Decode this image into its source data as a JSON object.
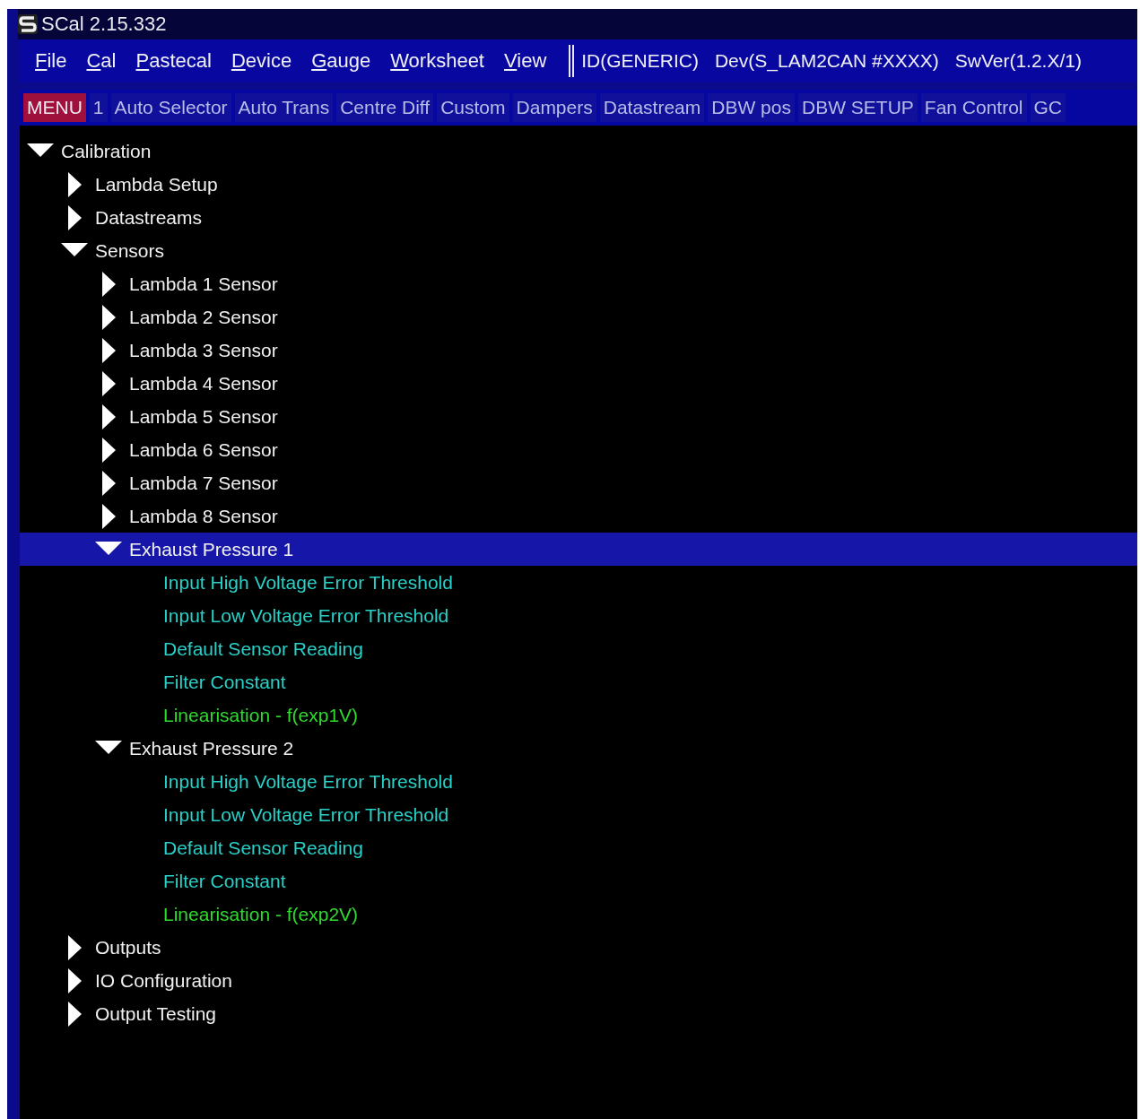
{
  "window": {
    "title": "SCal 2.15.332"
  },
  "menu": [
    {
      "key": "F",
      "rest": "ile"
    },
    {
      "key": "C",
      "rest": "al"
    },
    {
      "key": "P",
      "rest": "astecal"
    },
    {
      "key": "D",
      "rest": "evice"
    },
    {
      "key": "G",
      "rest": "auge"
    },
    {
      "key": "W",
      "rest": "orksheet"
    },
    {
      "key": "V",
      "rest": "iew"
    }
  ],
  "info": [
    "ID(GENERIC)",
    "Dev(S_LAM2CAN #XXXX)",
    "SwVer(1.2.X/1)"
  ],
  "tabs": [
    {
      "label": "MENU",
      "selected": true
    },
    {
      "label": "1",
      "selected": false
    },
    {
      "label": "Auto Selector",
      "selected": false
    },
    {
      "label": "Auto Trans",
      "selected": false
    },
    {
      "label": "Centre Diff",
      "selected": false
    },
    {
      "label": "Custom",
      "selected": false
    },
    {
      "label": "Dampers",
      "selected": false
    },
    {
      "label": "Datastream",
      "selected": false
    },
    {
      "label": "DBW pos",
      "selected": false
    },
    {
      "label": "DBW SETUP",
      "selected": false
    },
    {
      "label": "Fan Control",
      "selected": false
    },
    {
      "label": "GC",
      "selected": false
    }
  ],
  "tree": [
    {
      "kind": "folder",
      "label": "Calibration",
      "expanded": true,
      "selected": false,
      "children": [
        {
          "kind": "folder",
          "label": "Lambda Setup",
          "expanded": false,
          "selected": false
        },
        {
          "kind": "folder",
          "label": "Datastreams",
          "expanded": false,
          "selected": false
        },
        {
          "kind": "folder",
          "label": "Sensors",
          "expanded": true,
          "selected": false,
          "children": [
            {
              "kind": "folder",
              "label": "Lambda 1 Sensor",
              "expanded": false,
              "selected": false
            },
            {
              "kind": "folder",
              "label": "Lambda 2 Sensor",
              "expanded": false,
              "selected": false
            },
            {
              "kind": "folder",
              "label": "Lambda 3 Sensor",
              "expanded": false,
              "selected": false
            },
            {
              "kind": "folder",
              "label": "Lambda 4 Sensor",
              "expanded": false,
              "selected": false
            },
            {
              "kind": "folder",
              "label": "Lambda 5 Sensor",
              "expanded": false,
              "selected": false
            },
            {
              "kind": "folder",
              "label": "Lambda 6 Sensor",
              "expanded": false,
              "selected": false
            },
            {
              "kind": "folder",
              "label": "Lambda 7 Sensor",
              "expanded": false,
              "selected": false
            },
            {
              "kind": "folder",
              "label": "Lambda 8 Sensor",
              "expanded": false,
              "selected": false
            },
            {
              "kind": "folder",
              "label": "Exhaust Pressure 1",
              "expanded": true,
              "selected": true,
              "children": [
                {
                  "kind": "scalar",
                  "label": "Input High Voltage Error Threshold",
                  "selected": false
                },
                {
                  "kind": "scalar",
                  "label": "Input Low Voltage Error Threshold",
                  "selected": false
                },
                {
                  "kind": "scalar",
                  "label": "Default Sensor Reading",
                  "selected": false
                },
                {
                  "kind": "scalar",
                  "label": "Filter Constant",
                  "selected": false
                },
                {
                  "kind": "map",
                  "label": "Linearisation  - f(exp1V)",
                  "selected": false
                }
              ]
            },
            {
              "kind": "folder",
              "label": "Exhaust Pressure 2",
              "expanded": true,
              "selected": false,
              "children": [
                {
                  "kind": "scalar",
                  "label": "Input High Voltage Error Threshold",
                  "selected": false
                },
                {
                  "kind": "scalar",
                  "label": "Input Low Voltage Error Threshold",
                  "selected": false
                },
                {
                  "kind": "scalar",
                  "label": "Default Sensor Reading",
                  "selected": false
                },
                {
                  "kind": "scalar",
                  "label": "Filter Constant",
                  "selected": false
                },
                {
                  "kind": "map",
                  "label": "Linearisation  - f(exp2V)",
                  "selected": false
                }
              ]
            }
          ]
        },
        {
          "kind": "folder",
          "label": "Outputs",
          "expanded": false,
          "selected": false
        },
        {
          "kind": "folder",
          "label": "IO Configuration",
          "expanded": false,
          "selected": false
        },
        {
          "kind": "folder",
          "label": "Output Testing",
          "expanded": false,
          "selected": false
        }
      ]
    }
  ]
}
